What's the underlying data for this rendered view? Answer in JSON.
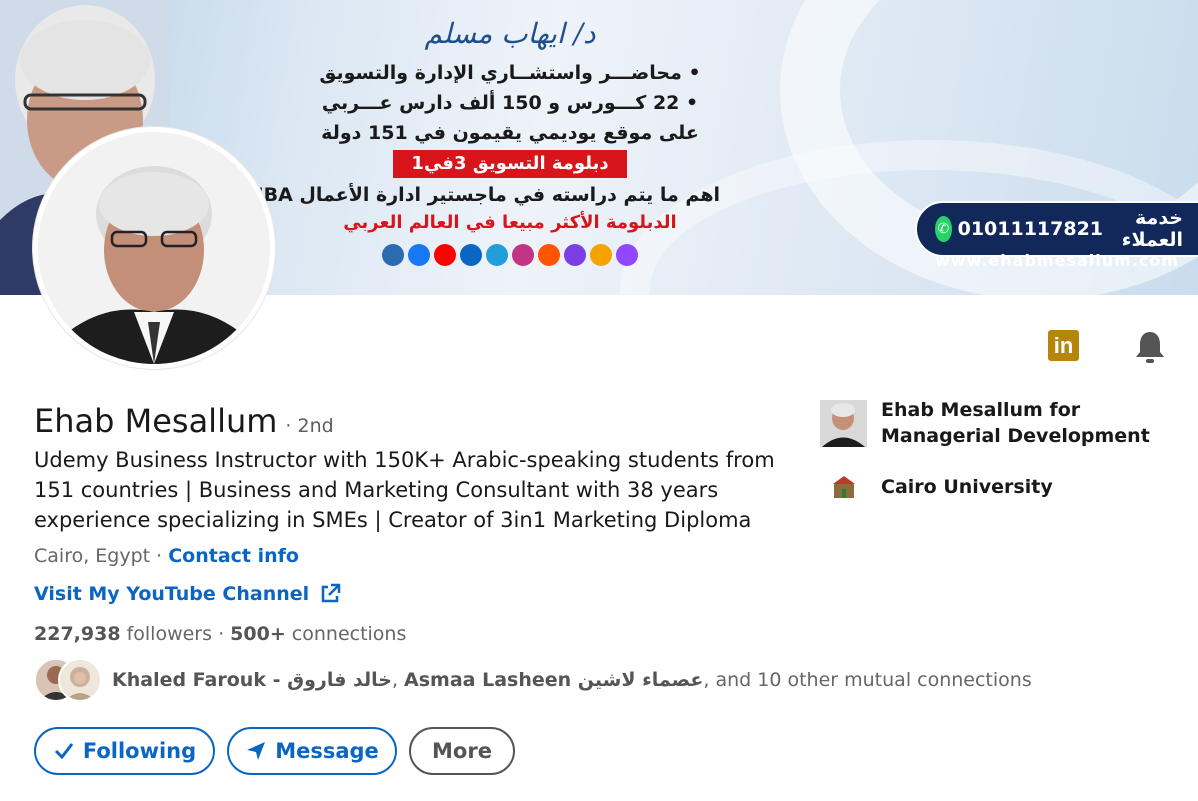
{
  "banner": {
    "logo_text": "د/ ايهاب مسلم",
    "line1": "• محاضـــر واستشــاري الإدارة والتسويق",
    "line2": "• 22 كـــورس و 150 ألف دارس عـــربي",
    "line3": "على موقع يوديمي يقيمون في 151 دولة",
    "pill": "دبلومة التسويق 3في1",
    "line4": "اهم ما يتم دراسته في ماجستير ادارة الأعمال MBA",
    "line5": "الدبلومة الأكثر مبيعا في العالم العربي",
    "phone": "01011117821",
    "phone_label": "خدمة العملاء",
    "website": "www.ehabmesallum.com",
    "social_colors": [
      "#2b6cb0",
      "#1877f2",
      "#ff0000",
      "#0a66c2",
      "#229ed9",
      "#c13584",
      "#ff5500",
      "#7b3fe4",
      "#f4a300",
      "#9146ff"
    ]
  },
  "profile": {
    "name": "Ehab Mesallum",
    "degree": "· 2nd",
    "headline": "Udemy Business Instructor with 150K+ Arabic-speaking students from 151 countries | Business and Marketing Consultant with 38 years experience specializing in SMEs | Creator of 3in1 Marketing Diploma",
    "location": "Cairo, Egypt",
    "location_sep": " · ",
    "contact_info": "Contact info",
    "youtube_link": "Visit My YouTube Channel",
    "followers_count": "227,938",
    "followers_label": " followers",
    "connections_sep": "  · ",
    "connections_count": "500+",
    "connections_label": " connections",
    "mutual_name1": "Khaled Farouk - خالد فاروق",
    "mutual_sep": ", ",
    "mutual_name2": "Asmaa Lasheen عصماء لاشين",
    "mutual_tail": ", and 10 other mutual connections"
  },
  "actions": {
    "following": "Following",
    "message": "Message",
    "more": "More"
  },
  "orgs": {
    "company": "Ehab Mesallum for Managerial Development",
    "school": "Cairo University"
  },
  "icons": {
    "linkedin": "in",
    "accent": "#0a66c2"
  }
}
